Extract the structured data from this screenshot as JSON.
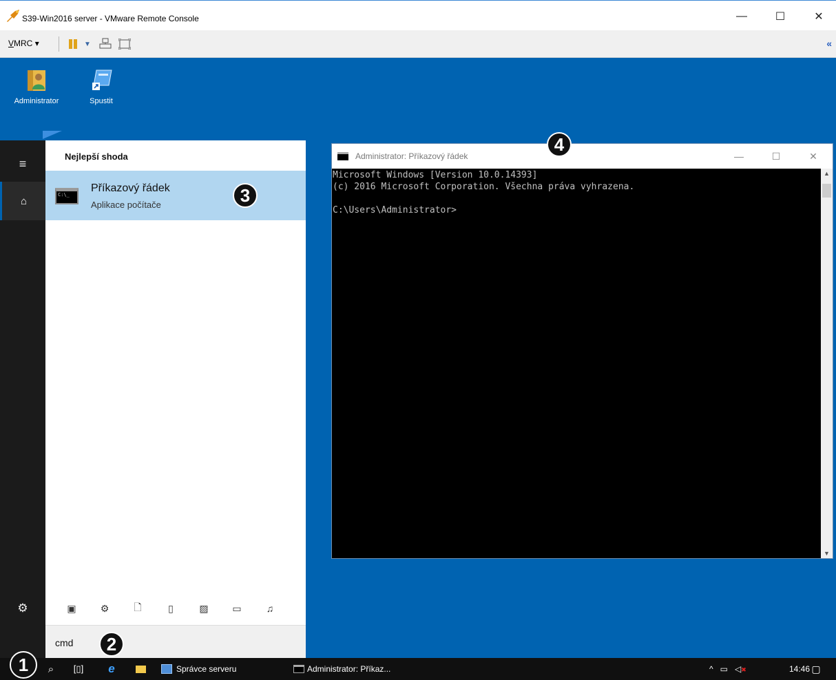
{
  "window": {
    "title": "S39-Win2016 server - VMware Remote Console",
    "minimize_glyph": "—",
    "maximize_glyph": "☐",
    "close_glyph": "✕"
  },
  "toolbar": {
    "vmrc_label": "VMRC",
    "vmrc_underlined": "V",
    "vmrc_rest": "MRC",
    "vmrc_caret": "▾",
    "collapse_glyph": "«",
    "icons": [
      "pause-icon",
      "dropdown-caret-icon",
      "send-ctrl-alt-del-icon",
      "fit-guest-icon"
    ]
  },
  "desktop": {
    "icons": [
      {
        "label": "Administrator",
        "icon": "user-folder-icon"
      },
      {
        "label": "Spustit",
        "icon": "run-shortcut-icon"
      }
    ]
  },
  "start_menu": {
    "section_heading": "Nejlepší shoda",
    "best_match": {
      "name": "Příkazový řádek",
      "subtitle": "Aplikace počítače",
      "icon_text": "C:\\_"
    },
    "rail": {
      "menu_glyph": "≡",
      "home_glyph": "⌂",
      "settings_glyph": "⚙"
    },
    "filters": [
      {
        "name": "apps-filter-icon",
        "glyph": "▣"
      },
      {
        "name": "settings-filter-icon",
        "glyph": "⚙"
      },
      {
        "name": "documents-filter-icon",
        "glyph": "🗋"
      },
      {
        "name": "folders-filter-icon",
        "glyph": "▯"
      },
      {
        "name": "photos-filter-icon",
        "glyph": "▨"
      },
      {
        "name": "videos-filter-icon",
        "glyph": "▭"
      },
      {
        "name": "music-filter-icon",
        "glyph": "♫"
      }
    ],
    "search_query": "cmd"
  },
  "cmd_window": {
    "title": "Administrator: Příkazový řádek",
    "lines": [
      "Microsoft Windows [Version 10.0.14393]",
      "(c) 2016 Microsoft Corporation. Všechna práva vyhrazena.",
      "",
      "C:\\Users\\Administrator>"
    ]
  },
  "callouts": [
    "1",
    "2",
    "3",
    "4"
  ],
  "taskbar": {
    "server_manager": "Správce serveru",
    "cmd_task": "Administrator: Příkaz...",
    "tray_up_glyph": "^",
    "clock": "14:46"
  },
  "colors": {
    "desktop": "#0063b1",
    "start_rail": "#1b1b1b",
    "selection": "#b1d6f0",
    "taskbar": "#101010",
    "callout": "#111111"
  }
}
